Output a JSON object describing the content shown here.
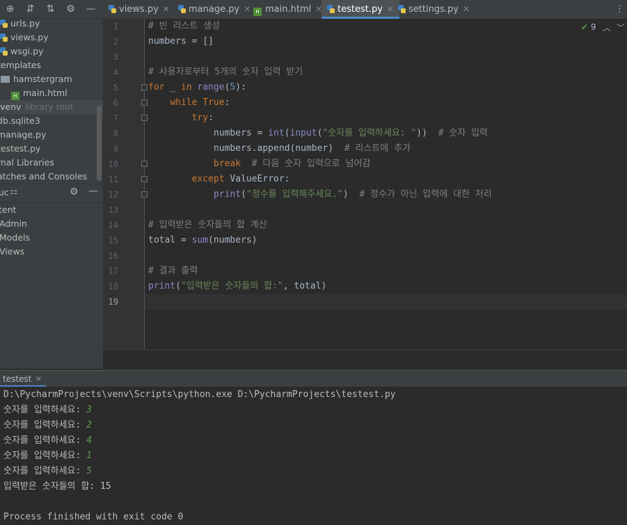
{
  "project_panel": {
    "toolbar_icons": [
      "crosshair-icon",
      "expand-all-icon",
      "collapse-all-icon",
      "gear-icon",
      "minimize-icon"
    ],
    "items": [
      {
        "label": "urls.py",
        "icon": "python-file-icon"
      },
      {
        "label": "views.py",
        "icon": "python-file-icon"
      },
      {
        "label": "wsgi.py",
        "icon": "python-file-icon"
      },
      {
        "label": "templates",
        "icon": ""
      },
      {
        "label": "hamstergram",
        "icon": "folder-icon"
      },
      {
        "label": "main.html",
        "icon": "html-file-icon"
      },
      {
        "label": "venv",
        "icon": "",
        "suffix": "library root"
      },
      {
        "label": "db.sqlite3",
        "icon": ""
      },
      {
        "label": "manage.py",
        "icon": ""
      },
      {
        "label": "testest.py",
        "icon": ""
      },
      {
        "label": "rnal Libraries",
        "icon": ""
      },
      {
        "label": "atches and Consoles",
        "icon": ""
      }
    ],
    "structure_title": "uc",
    "structure_items": [
      "tent",
      "Admin",
      "Models",
      "Views"
    ]
  },
  "tabs": [
    {
      "label": "views.py",
      "active": false
    },
    {
      "label": "manage.py",
      "active": false
    },
    {
      "label": "main.html",
      "active": false
    },
    {
      "label": "testest.py",
      "active": true
    },
    {
      "label": "settings.py",
      "active": false
    }
  ],
  "editor": {
    "inspection_count": "9",
    "current_line": 19,
    "line_numbers": [
      "1",
      "2",
      "3",
      "4",
      "5",
      "6",
      "7",
      "8",
      "9",
      "10",
      "11",
      "12",
      "13",
      "14",
      "15",
      "16",
      "17",
      "18",
      "19"
    ]
  },
  "code_lines": [
    [
      {
        "t": "# 빈 리스트 생성",
        "c": "cm"
      }
    ],
    [
      {
        "t": "numbers = []",
        "c": ""
      }
    ],
    [],
    [
      {
        "t": "# 사용자로부터 5개의 숫자 입력 받기",
        "c": "cm"
      }
    ],
    [
      {
        "t": "for",
        "c": "kw"
      },
      {
        "t": " _ ",
        "c": ""
      },
      {
        "t": "in",
        "c": "kw"
      },
      {
        "t": " ",
        "c": ""
      },
      {
        "t": "range",
        "c": "bi"
      },
      {
        "t": "(",
        "c": ""
      },
      {
        "t": "5",
        "c": "num"
      },
      {
        "t": "):",
        "c": ""
      }
    ],
    [
      {
        "t": "    ",
        "c": ""
      },
      {
        "t": "while",
        "c": "kw"
      },
      {
        "t": " ",
        "c": ""
      },
      {
        "t": "True",
        "c": "kw"
      },
      {
        "t": ":",
        "c": ""
      }
    ],
    [
      {
        "t": "        ",
        "c": ""
      },
      {
        "t": "try",
        "c": "kw"
      },
      {
        "t": ":",
        "c": ""
      }
    ],
    [
      {
        "t": "            numbers = ",
        "c": ""
      },
      {
        "t": "int",
        "c": "bi"
      },
      {
        "t": "(",
        "c": ""
      },
      {
        "t": "input",
        "c": "bi"
      },
      {
        "t": "(",
        "c": ""
      },
      {
        "t": "\"숫자를 입력하세요: \"",
        "c": "str"
      },
      {
        "t": "))  ",
        "c": ""
      },
      {
        "t": "# 숫자 입력",
        "c": "cm"
      }
    ],
    [
      {
        "t": "            numbers.append(number)  ",
        "c": ""
      },
      {
        "t": "# 리스트에 추가",
        "c": "cm"
      }
    ],
    [
      {
        "t": "            ",
        "c": ""
      },
      {
        "t": "break",
        "c": "kw"
      },
      {
        "t": "  ",
        "c": ""
      },
      {
        "t": "# 다음 숫자 입력으로 넘어감",
        "c": "cm"
      }
    ],
    [
      {
        "t": "        ",
        "c": ""
      },
      {
        "t": "except",
        "c": "kw"
      },
      {
        "t": " ValueError:",
        "c": ""
      }
    ],
    [
      {
        "t": "            ",
        "c": ""
      },
      {
        "t": "print",
        "c": "bi"
      },
      {
        "t": "(",
        "c": ""
      },
      {
        "t": "\"정수를 입력해주세요.\"",
        "c": "str"
      },
      {
        "t": ")  ",
        "c": ""
      },
      {
        "t": "# 정수가 아닌 입력에 대한 처리",
        "c": "cm"
      }
    ],
    [],
    [
      {
        "t": "# 입력받은 숫자들의 합 계산",
        "c": "cm"
      }
    ],
    [
      {
        "t": "total = ",
        "c": ""
      },
      {
        "t": "sum",
        "c": "bi"
      },
      {
        "t": "(numbers)",
        "c": ""
      }
    ],
    [],
    [
      {
        "t": "# 결과 출력",
        "c": "cm"
      }
    ],
    [
      {
        "t": "print",
        "c": "bi"
      },
      {
        "t": "(",
        "c": ""
      },
      {
        "t": "\"입력받은 숫자들의 합:\"",
        "c": "str"
      },
      {
        "t": ", total)",
        "c": ""
      }
    ],
    []
  ],
  "run": {
    "tab_label": "testest",
    "command": "D:\\PycharmProjects\\venv\\Scripts\\python.exe D:\\PycharmProjects\\testest.py",
    "prompts": [
      {
        "prompt": "숫자를 입력하세요: ",
        "input": "3"
      },
      {
        "prompt": "숫자를 입력하세요: ",
        "input": "2"
      },
      {
        "prompt": "숫자를 입력하세요: ",
        "input": "4"
      },
      {
        "prompt": "숫자를 입력하세요: ",
        "input": "1"
      },
      {
        "prompt": "숫자를 입력하세요: ",
        "input": "5"
      }
    ],
    "result": "입력받은 숫자들의 합: 15",
    "exit": "Process finished with exit code 0"
  }
}
